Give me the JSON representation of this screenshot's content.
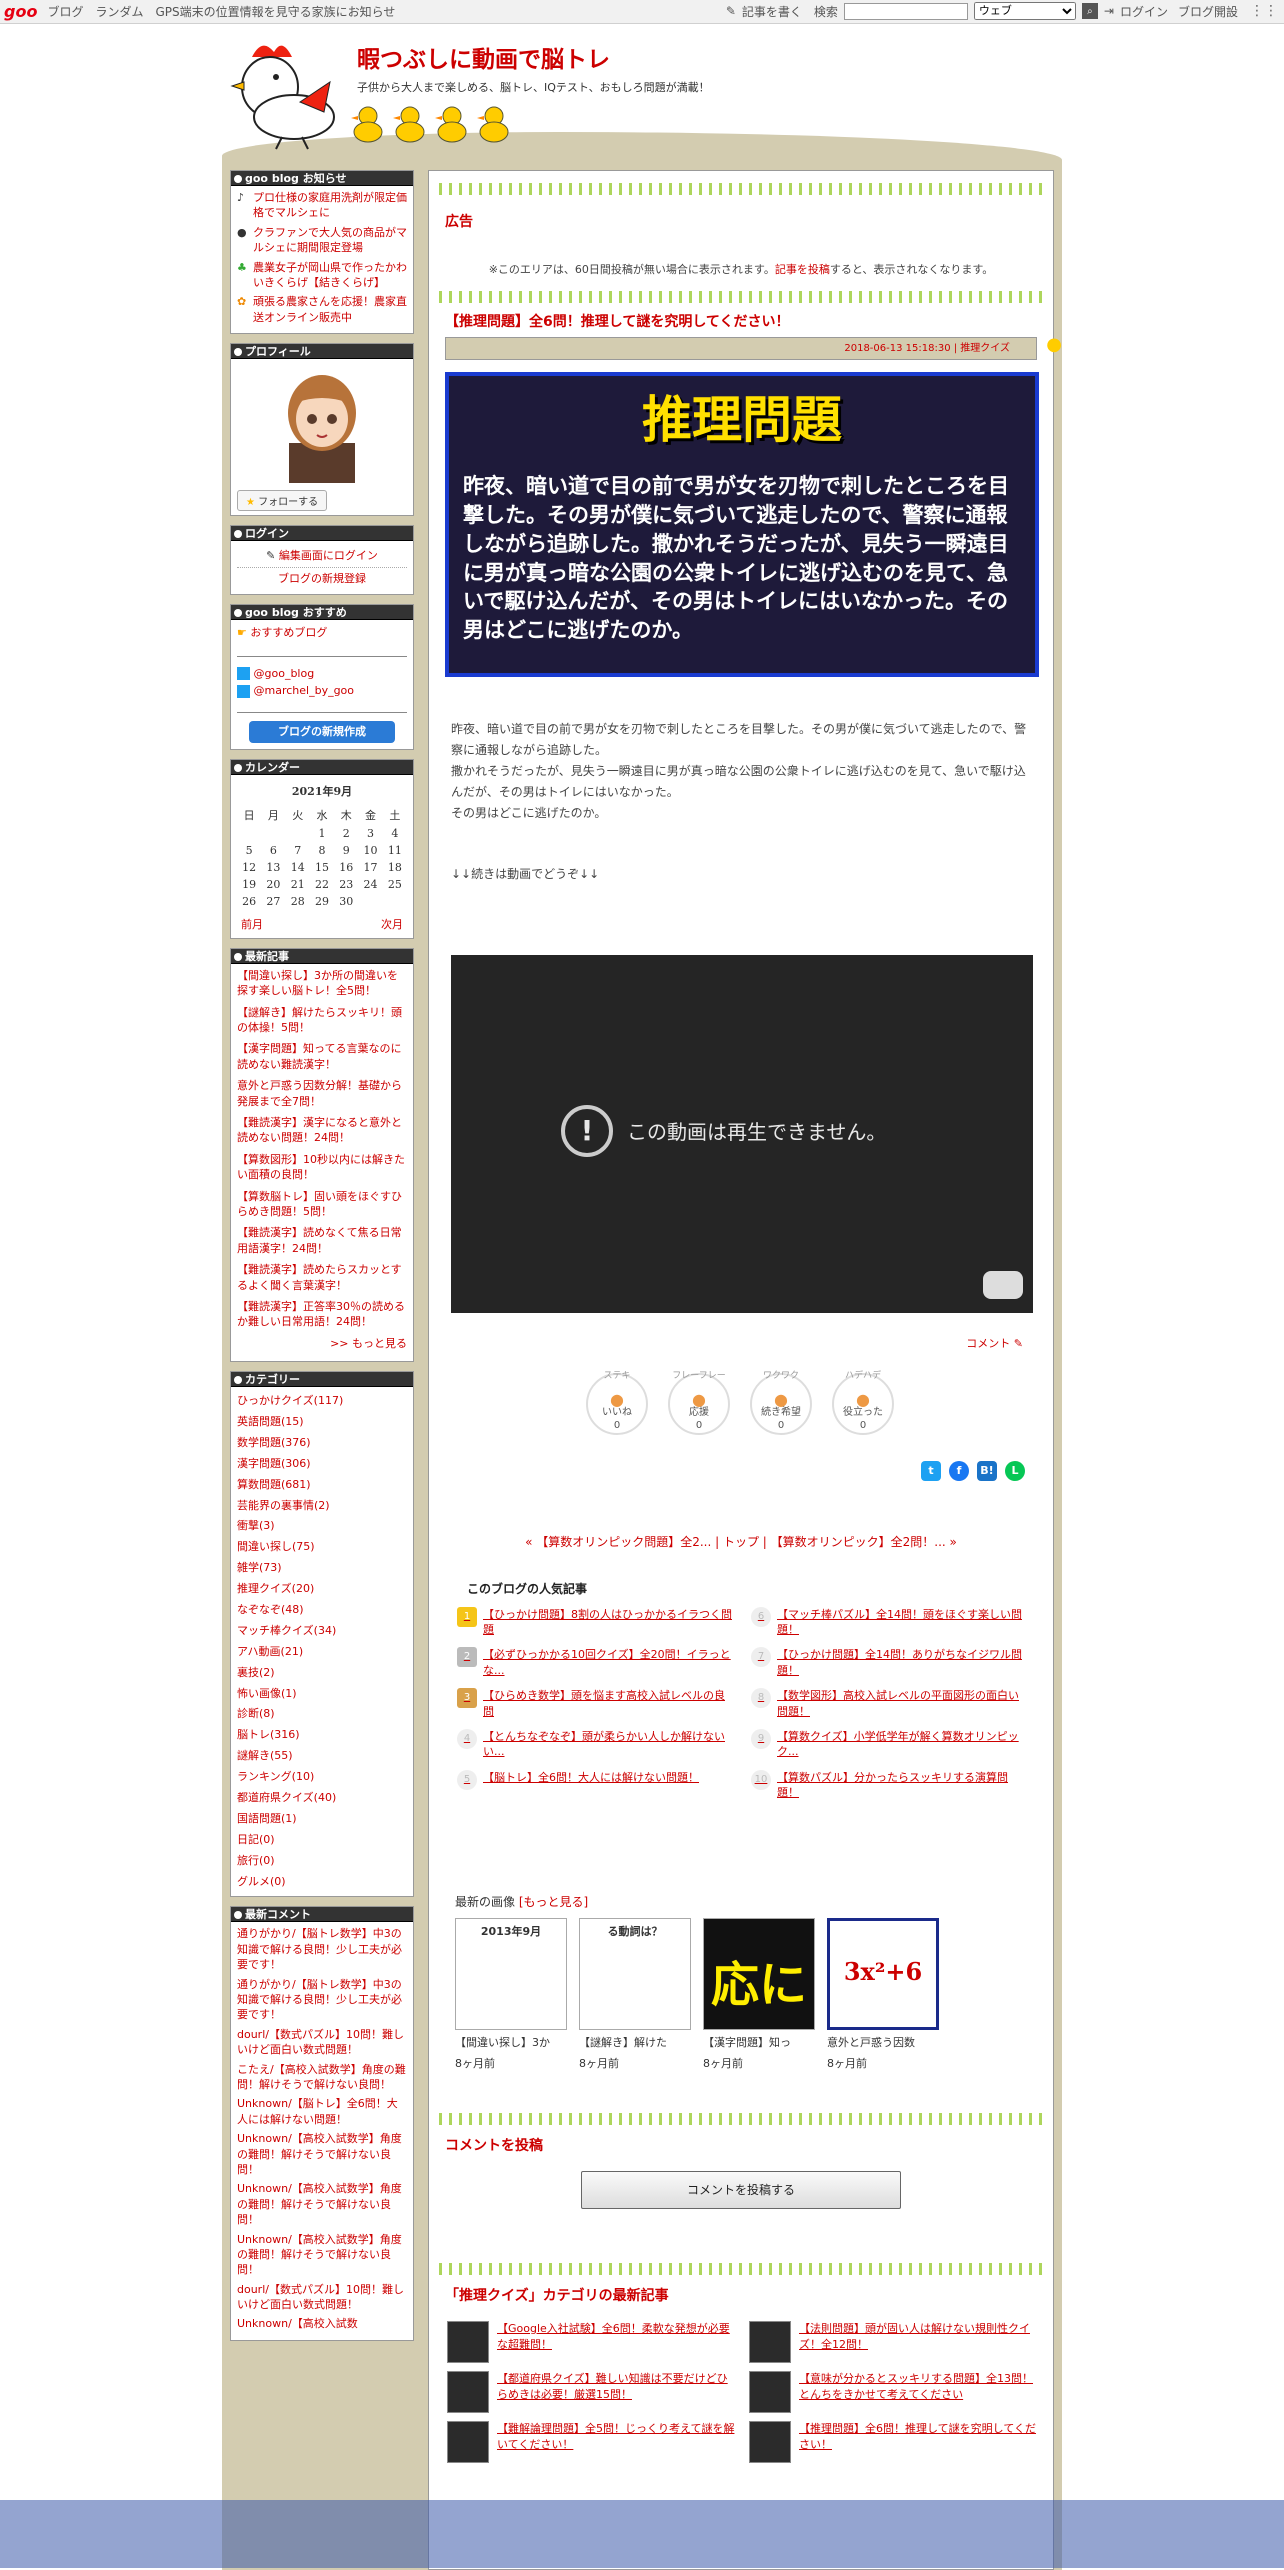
{
  "topbar": {
    "logo": "goo",
    "nav": [
      "ブログ",
      "ランダム",
      "GPS端末の位置情報を見守る家族にお知らせ"
    ],
    "write": "記事を書く",
    "search_label": "検索",
    "select": "ウェブ",
    "login": "ログイン",
    "open": "ブログ開設"
  },
  "header": {
    "title": "暇つぶしに動画で脳トレ",
    "desc": "子供から大人まで楽しめる、脳トレ、IQテスト、おもしろ問題が満載！"
  },
  "sidebar": {
    "ads_title": "goo blog お知らせ",
    "ads": [
      "プロ仕様の家庭用洗剤が限定価格でマルシェに",
      "クラファンで大人気の商品がマルシェに期間限定登場",
      "農業女子が岡山県で作ったかわいきくらげ【結きくらげ】",
      "頑張る農家さんを応援！農家直送オンライン販売中"
    ],
    "profile_title": "プロフィール",
    "follow": "フォローする",
    "login_title": "ログイン",
    "login_edit": "編集画面にログイン",
    "login_new": "ブログの新規登録",
    "recommend_title": "goo blog おすすめ",
    "recommend_link": "おすすめブログ",
    "tw1": "@goo_blog",
    "tw2": "@marchel_by_goo",
    "new_blog_btn": "ブログの新規作成",
    "calendar_title": "カレンダー",
    "calendar_month": "2021年9月",
    "calendar_head": [
      "日",
      "月",
      "火",
      "水",
      "木",
      "金",
      "土"
    ],
    "calendar_rows": [
      [
        "",
        "",
        "",
        "1",
        "2",
        "3",
        "4"
      ],
      [
        "5",
        "6",
        "7",
        "8",
        "9",
        "10",
        "11"
      ],
      [
        "12",
        "13",
        "14",
        "15",
        "16",
        "17",
        "18"
      ],
      [
        "19",
        "20",
        "21",
        "22",
        "23",
        "24",
        "25"
      ],
      [
        "26",
        "27",
        "28",
        "29",
        "30",
        "",
        ""
      ]
    ],
    "cal_prev": "前月",
    "cal_next": "次月",
    "recent_title": "最新記事",
    "recent": [
      "【間違い探し】3か所の間違いを探す楽しい脳トレ！全5問！",
      "【謎解き】解けたらスッキリ！頭の体操！5問！",
      "【漢字問題】知ってる言葉なのに読めない難読漢字！",
      "意外と戸惑う因数分解！基礎から発展まで全7問！",
      "【難読漢字】漢字になると意外と読めない問題！24問！",
      "【算数図形】10秒以内には解きたい面積の良問！",
      "【算数脳トレ】固い頭をほぐすひらめき問題！5問！",
      "【難読漢字】読めなくて焦る日常用語漢字！24問！",
      "【難読漢字】読めたらスカッとするよく聞く言葉漢字！",
      "【難読漢字】正答率30％の読めるか難しい日常用語！24問！"
    ],
    "recent_more": ">> もっと見る",
    "category_title": "カテゴリー",
    "categories": [
      "ひっかけクイズ(117)",
      "英語問題(15)",
      "数学問題(376)",
      "漢字問題(306)",
      "算数問題(681)",
      "芸能界の裏事情(2)",
      "衝撃(3)",
      "間違い探し(75)",
      "雑学(73)",
      "推理クイズ(20)",
      "なぞなぞ(48)",
      "マッチ棒クイズ(34)",
      "アハ動画(21)",
      "裏技(2)",
      "怖い画像(1)",
      "診断(8)",
      "脳トレ(316)",
      "謎解き(55)",
      "ランキング(10)",
      "都道府県クイズ(40)",
      "国語問題(1)",
      "日記(0)",
      "旅行(0)",
      "グルメ(0)"
    ],
    "comment_title": "最新コメント",
    "comments": [
      "通りがかり/【脳トレ数学】中3の知識で解ける良問！少し工夫が必要です！",
      "通りがかり/【脳トレ数学】中3の知識で解ける良問！少し工夫が必要です！",
      "dourl/【数式パズル】10問！難しいけど面白い数式問題！",
      "こたえ/【高校入試数学】角度の難問！解けそうで解けない良問！",
      "Unknown/【脳トレ】全6問！大人には解けない問題！",
      "Unknown/【高校入試数学】角度の難問！解けそうで解けない良問！",
      "Unknown/【高校入試数学】角度の難問！解けそうで解けない良問！",
      "Unknown/【高校入試数学】角度の難問！解けそうで解けない良問！",
      "dourl/【数式パズル】10問！難しいけど面白い数式問題！",
      "Unknown/【高校入試数"
    ]
  },
  "main": {
    "ad_title": "広告",
    "ad_note_1": "※このエリアは、60日間投稿が無い場合に表示されます。",
    "ad_note_link": "記事を投稿",
    "ad_note_2": "すると、表示されなくなります。",
    "article_title": "【推理問題】全6問！推理して謎を究明してください！",
    "article_meta": "2018-06-13 15:18:30 | 推理クイズ",
    "banner_title": "推理問題",
    "banner_text": "昨夜、暗い道で目の前で男が女を刃物で刺したところを目撃した。その男が僕に気づいて逃走したので、警察に通報しながら追跡した。撒かれそうだったが、見失う一瞬遠目に男が真っ暗な公園の公衆トイレに逃げ込むのを見て、急いで駆け込んだが、その男はトイレにはいなかった。その男はどこに逃げたのか。",
    "body_1": "昨夜、暗い道で目の前で男が女を刃物で刺したところを目撃した。その男が僕に気づいて逃走したので、警察に通報しながら追跡した。",
    "body_2": "撒かれそうだったが、見失う一瞬遠目に男が真っ暗な公園の公衆トイレに逃げ込むのを見て、急いで駆け込んだが、その男はトイレにはいなかった。",
    "body_3": "その男はどこに逃げたのか。",
    "body_4": "↓↓続きは動画でどうぞ↓↓",
    "video_msg": "この動画は再生できません。",
    "comment_link": "コメント",
    "reactions": [
      {
        "top": "ステキ",
        "label": "いいね",
        "count": "0"
      },
      {
        "top": "フレーフレー",
        "label": "応援",
        "count": "0"
      },
      {
        "top": "ワクワク",
        "label": "続き希望",
        "count": "0"
      },
      {
        "top": "ハデハデ",
        "label": "役立った",
        "count": "0"
      }
    ],
    "pager": "« 【算数オリンピック問題】全2... | トップ | 【算数オリンピック】全2問！... »",
    "popular_title": "このブログの人気記事",
    "popular": [
      {
        "rank": "1",
        "text": "【ひっかけ問題】8割の人はひっかかるイラつく問題"
      },
      {
        "rank": "6",
        "text": "【マッチ棒パズル】全14問！頭をほぐす楽しい問題！"
      },
      {
        "rank": "2",
        "text": "【必ずひっかかる10回クイズ】全20問！イラっとな..."
      },
      {
        "rank": "7",
        "text": "【ひっかけ問題】全14問！ありがちなイジワル問題！"
      },
      {
        "rank": "3",
        "text": "【ひらめき数学】頭を悩ます高校入試レベルの良問"
      },
      {
        "rank": "8",
        "text": "【数学図形】高校入試レベルの平面図形の面白い問題！"
      },
      {
        "rank": "4",
        "text": "【とんちなぞなぞ】頭が柔らかい人しか解けないい..."
      },
      {
        "rank": "9",
        "text": "【算数クイズ】小学低学年が解く算数オリンピック..."
      },
      {
        "rank": "5",
        "text": "【脳トレ】全6問！大人には解けない問題！"
      },
      {
        "rank": "10",
        "text": "【算数パズル】分かったらスッキリする演算問題！"
      }
    ],
    "images_title": "最新の画像",
    "images_more": "[もっと見る]",
    "images": [
      {
        "cap": "【間違い探し】3か",
        "ago": "8ヶ月前",
        "thumb": "2013年9月"
      },
      {
        "cap": "【謎解き】解けた",
        "ago": "8ヶ月前",
        "thumb": "る動詞は？"
      },
      {
        "cap": "【漢字問題】知っ",
        "ago": "8ヶ月前",
        "thumb": "応に"
      },
      {
        "cap": "意外と戸惑う因数",
        "ago": "8ヶ月前",
        "thumb": "3x²+6"
      }
    ],
    "post_comment_title": "コメントを投稿",
    "post_comment_btn": "コメントを投稿する",
    "latest_title": "「推理クイズ」カテゴリの最新記事",
    "latest": [
      "【Google入社試験】全6問！柔軟な発想が必要な超難問！",
      "【法則問題】頭が固い人は解けない規則性クイズ！全12問！",
      "【都道府県クイズ】難しい知識は不要だけどひらめきは必要！厳選15問！",
      "【意味が分かるとスッキリする問題】全13問！とんちをきかせて考えてください",
      "【難解論理問題】全5問！じっくり考えて謎を解いてください！",
      "【推理問題】全6問！推理して謎を究明してください！"
    ]
  }
}
